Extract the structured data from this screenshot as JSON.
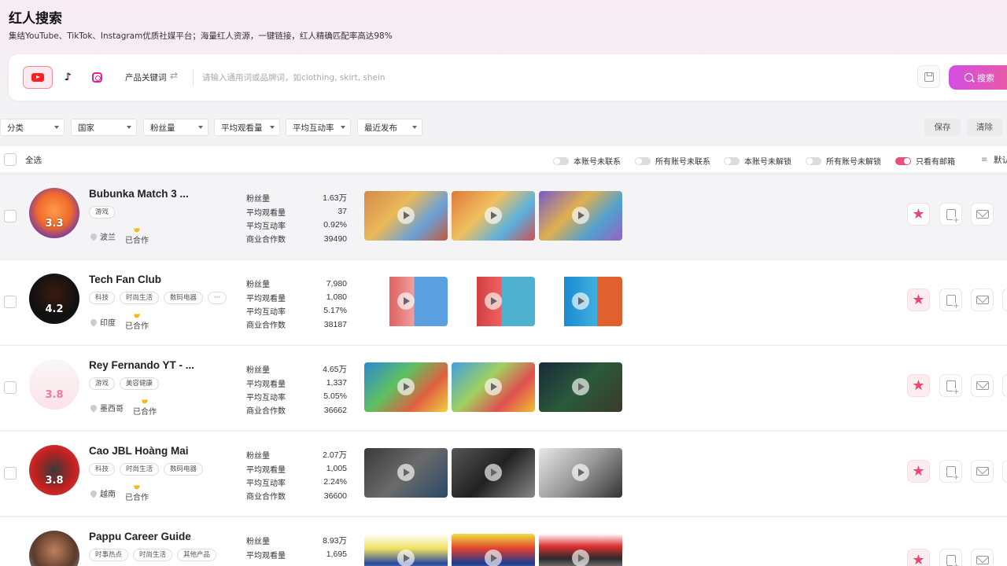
{
  "header": {
    "title": "红人搜索",
    "subtitle": "集结YouTube、TikTok、Instagram优质社媒平台；海量红人资源，一键链接，红人精确匹配率高达98%"
  },
  "search": {
    "platforms": [
      "youtube",
      "tiktok",
      "instagram"
    ],
    "selected_platform": "youtube",
    "mode_label": "产品关键词",
    "placeholder": "请输入通用词或品牌词，如clothing, skirt, shein",
    "button_label": "搜索"
  },
  "filters": {
    "items": [
      "分类",
      "国家",
      "粉丝量",
      "平均观看量",
      "平均互动率",
      "最近发布"
    ],
    "save_label": "保存",
    "clear_label": "清除"
  },
  "selection": {
    "select_all": "全选",
    "toggles": [
      {
        "label": "本账号未联系",
        "on": false
      },
      {
        "label": "所有账号未联系",
        "on": false
      },
      {
        "label": "本账号未解锁",
        "on": false
      },
      {
        "label": "所有账号未解锁",
        "on": false
      },
      {
        "label": "只看有邮箱",
        "on": true
      }
    ],
    "sort_label": "默认"
  },
  "stat_labels": [
    "粉丝量",
    "平均观看量",
    "平均互动率",
    "商业合作数"
  ],
  "influencers": [
    {
      "name": "Bubunka Match 3 ...",
      "score": "3.3",
      "tags": [
        "游戏"
      ],
      "country": "波兰",
      "collab": "已合作",
      "followers": "1.63万",
      "avg_views": "37",
      "engagement": "0.92%",
      "deals": "39490",
      "favorited": true
    },
    {
      "name": "Tech Fan Club",
      "score": "4.2",
      "tags": [
        "科技",
        "时尚生活",
        "数码电器"
      ],
      "more": "···",
      "country": "印度",
      "collab": "已合作",
      "followers": "7,980",
      "avg_views": "1,080",
      "engagement": "5.17%",
      "deals": "38187",
      "favorited": true
    },
    {
      "name": "Rey Fernando YT - ...",
      "score": "3.8",
      "tags": [
        "游戏",
        "美容健康"
      ],
      "country": "墨西哥",
      "collab": "已合作",
      "followers": "4.65万",
      "avg_views": "1,337",
      "engagement": "5.05%",
      "deals": "36662",
      "favorited": true
    },
    {
      "name": "Cao JBL Hoàng Mai",
      "score": "3.8",
      "tags": [
        "科技",
        "时尚生活",
        "数码电器"
      ],
      "country": "越南",
      "collab": "已合作",
      "followers": "2.07万",
      "avg_views": "1,005",
      "engagement": "2.24%",
      "deals": "36600",
      "favorited": true
    },
    {
      "name": "Pappu Career Guide",
      "score": "",
      "tags": [
        "时事热点",
        "时尚生活",
        "其他产品"
      ],
      "country": "",
      "collab": "",
      "followers": "8.93万",
      "avg_views": "1,695",
      "engagement": "",
      "deals": "",
      "favorited": true
    }
  ],
  "colors": {
    "accent": "#e8476e",
    "search_button_start": "#d24ee3",
    "search_button_end": "#ee5a9e"
  }
}
